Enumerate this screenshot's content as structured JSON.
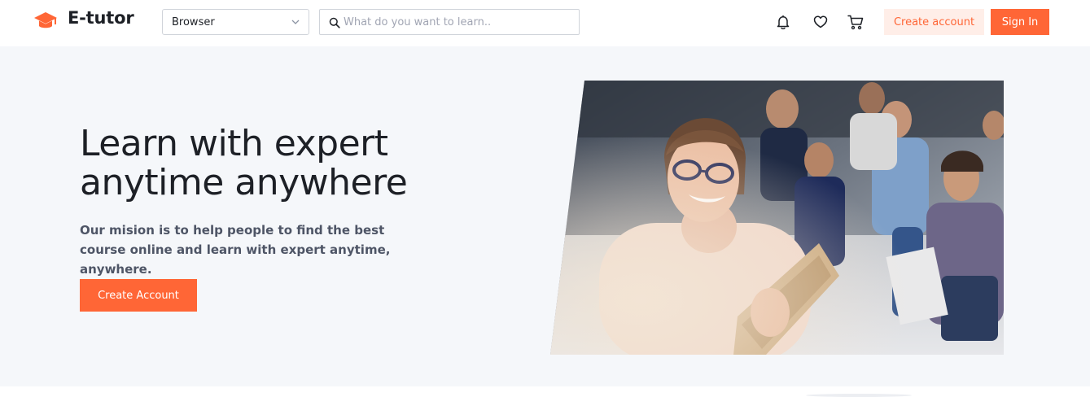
{
  "brand": {
    "name": "E-tutor",
    "accent": "#ff6636"
  },
  "header": {
    "category_select": {
      "value": "Browser"
    },
    "search": {
      "placeholder": "What do you want to learn.."
    },
    "icons": [
      "bell-icon",
      "heart-icon",
      "cart-icon"
    ],
    "create_account_label": "Create account",
    "sign_in_label": "Sign In"
  },
  "hero": {
    "title_line1": "Learn with expert",
    "title_line2": "anytime anywhere",
    "description": "Our mision is to help people to find the best course online and learn with expert anytime, anywhere.",
    "cta_label": "Create Account"
  },
  "colors": {
    "primary": "#ff6636",
    "primary_tint": "#ffeee8",
    "hero_bg": "#f5f7fa",
    "text_dark": "#1d2026",
    "text_gray": "#4e5566"
  }
}
